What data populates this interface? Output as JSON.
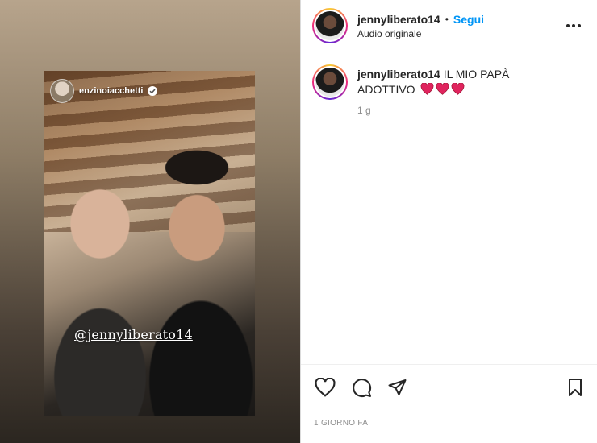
{
  "media": {
    "story_username": "enzinoiacchetti",
    "mention": "@jennyliberato14"
  },
  "post": {
    "username": "jennyliberato14",
    "separator": "•",
    "follow_label": "Segui",
    "audio": "Audio originale",
    "caption": {
      "username": "jennyliberato14",
      "text": "IL MIO PAPÀ ADOTTIVO",
      "time": "1 g"
    },
    "date": "1 GIORNO FA"
  },
  "icons": {
    "more": "more-options-icon",
    "like": "heart-outline-icon",
    "comment": "comment-icon",
    "share": "paper-plane-icon",
    "save": "bookmark-icon",
    "verified": "verified-badge-icon",
    "hearts": "red-heart-emoji"
  },
  "colors": {
    "accent": "#0095f6",
    "heart": "#e0245e",
    "muted": "#8e8e8e"
  }
}
